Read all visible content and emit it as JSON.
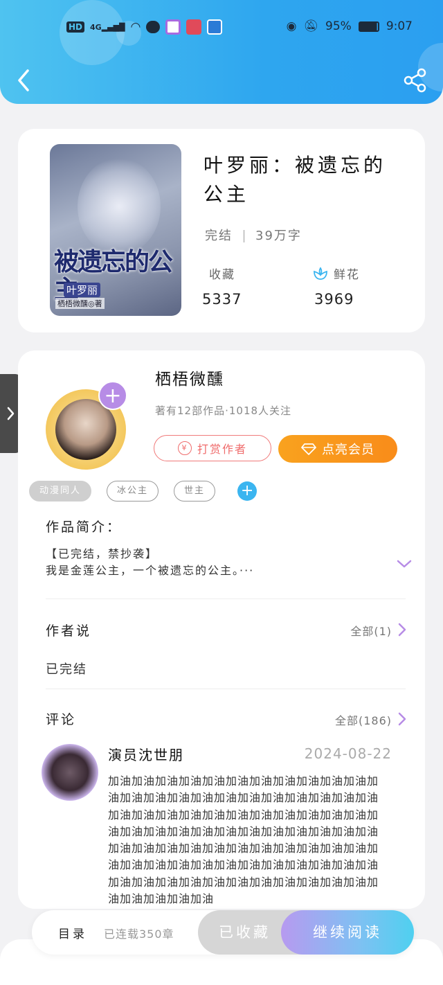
{
  "status_bar": {
    "network": "HD",
    "signal": "4G",
    "battery": "95%",
    "time": "9:07"
  },
  "book": {
    "cover_title": "被遗忘的公主",
    "cover_subtitle": "叶罗丽",
    "cover_author": "栖梧微醺◎著",
    "title": "叶罗丽：被遗忘的公主",
    "status": "完结",
    "word_count": "39万字",
    "collect_label": "收藏",
    "collect_count": "5337",
    "flower_label": "鲜花",
    "flower_count": "3969"
  },
  "author": {
    "name": "栖梧微醺",
    "summary": "著有12部作品·1018人关注",
    "tip_button": "打赏作者",
    "tip_icon_text": "¥",
    "vip_button": "点亮会员"
  },
  "tags": [
    "动漫同人",
    "冰公主",
    "世主"
  ],
  "intro": {
    "title": "作品简介：",
    "line1": "【已完结，禁抄袭】",
    "line2": "我是金莲公主，一个被遗忘的公主。···"
  },
  "author_says": {
    "title": "作者说",
    "more": "全部(1)",
    "content": "已完结"
  },
  "comments": {
    "title": "评论",
    "more": "全部(186)",
    "items": [
      {
        "user": "演员沈世朋",
        "date": "2024-08-22",
        "text": "加油加油加油加油加油加油加油加油加油加油加油加油加油加油加油加油加油加油加油加油加油加油加油加油加油加油加油加油加油加油加油加油加油加油加油加油加油加油加油加油加油加油加油加油加油加油加油加油加油加油加油加油加油加油加油加油加油加油加油加油加油加油加油加油加油加油加油加油加油加油加油加油加油加油加油加油加油加油加油加油加油加油加油加油加油"
      }
    ]
  },
  "bottom_bar": {
    "toc": "目录",
    "serial": "已连载350章",
    "collected": "已收藏",
    "continue_read": "继续阅读"
  },
  "colors": {
    "header": "#2ea6ef",
    "vip": "#f9a21e",
    "tip": "#ef6b6b",
    "accent_purple": "#b78ce6",
    "tag_add": "#3bb5f0"
  }
}
